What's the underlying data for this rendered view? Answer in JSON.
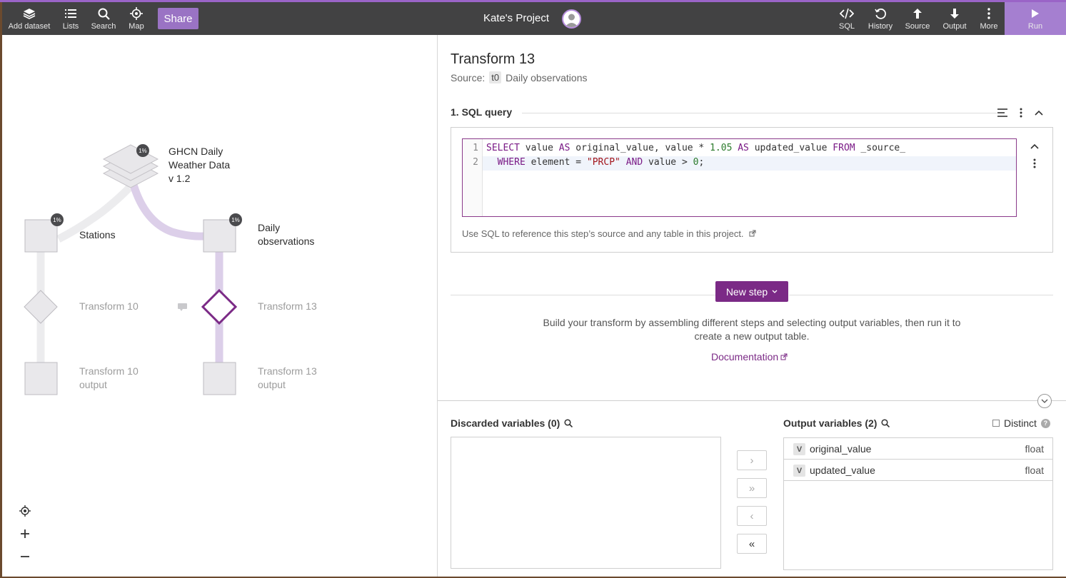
{
  "toolbar": {
    "left": [
      {
        "label": "Add dataset",
        "icon": "layers-icon"
      },
      {
        "label": "Lists",
        "icon": "list-icon"
      },
      {
        "label": "Search",
        "icon": "search-icon"
      },
      {
        "label": "Map",
        "icon": "map-locate-icon"
      }
    ],
    "share_label": "Share",
    "project_title": "Kate's Project",
    "right": [
      {
        "label": "SQL",
        "icon": "code-icon"
      },
      {
        "label": "History",
        "icon": "history-icon"
      },
      {
        "label": "Source",
        "icon": "arrow-up-icon"
      },
      {
        "label": "Output",
        "icon": "arrow-down-icon"
      },
      {
        "label": "More",
        "icon": "more-vertical-icon"
      }
    ],
    "run_label": "Run",
    "accent_color": "#9a64c7"
  },
  "graph": {
    "dataset": {
      "title_lines": [
        "GHCN Daily",
        "Weather Data",
        "v 1.2"
      ],
      "badge": "1%"
    },
    "tables": [
      {
        "label": "Stations",
        "badge": "1%"
      },
      {
        "label_lines": [
          "Daily",
          "observations"
        ],
        "badge": "1%"
      }
    ],
    "transforms": [
      {
        "label": "Transform 10"
      },
      {
        "label": "Transform 13"
      }
    ],
    "outputs": [
      {
        "label_lines": [
          "Transform 10",
          "output"
        ]
      },
      {
        "label_lines": [
          "Transform 13",
          "output"
        ]
      }
    ]
  },
  "transform": {
    "title": "Transform 13",
    "source_prefix": "Source:",
    "source_pill": "t0",
    "source_name": "Daily observations",
    "step": {
      "title": "1. SQL query",
      "code_lines": [
        "SELECT value AS original_value, value * 1.05 AS updated_value FROM _source_",
        "  WHERE element = \"PRCP\" AND value > 0;"
      ],
      "line_numbers": [
        "1",
        "2"
      ],
      "hint": "Use SQL to reference this step’s source and any table in this project."
    },
    "new_step_label": "New step",
    "build_text": "Build your transform by assembling different steps and selecting output variables, then run it to create a new output table.",
    "documentation_label": "Documentation"
  },
  "variables": {
    "discarded_title": "Discarded variables (0)",
    "output_title": "Output variables (2)",
    "distinct_label": "Distinct",
    "outputs": [
      {
        "badge": "V",
        "name": "original_value",
        "type": "float"
      },
      {
        "badge": "V",
        "name": "updated_value",
        "type": "float"
      }
    ],
    "move_buttons": [
      "›",
      "»",
      "‹",
      "«"
    ]
  }
}
